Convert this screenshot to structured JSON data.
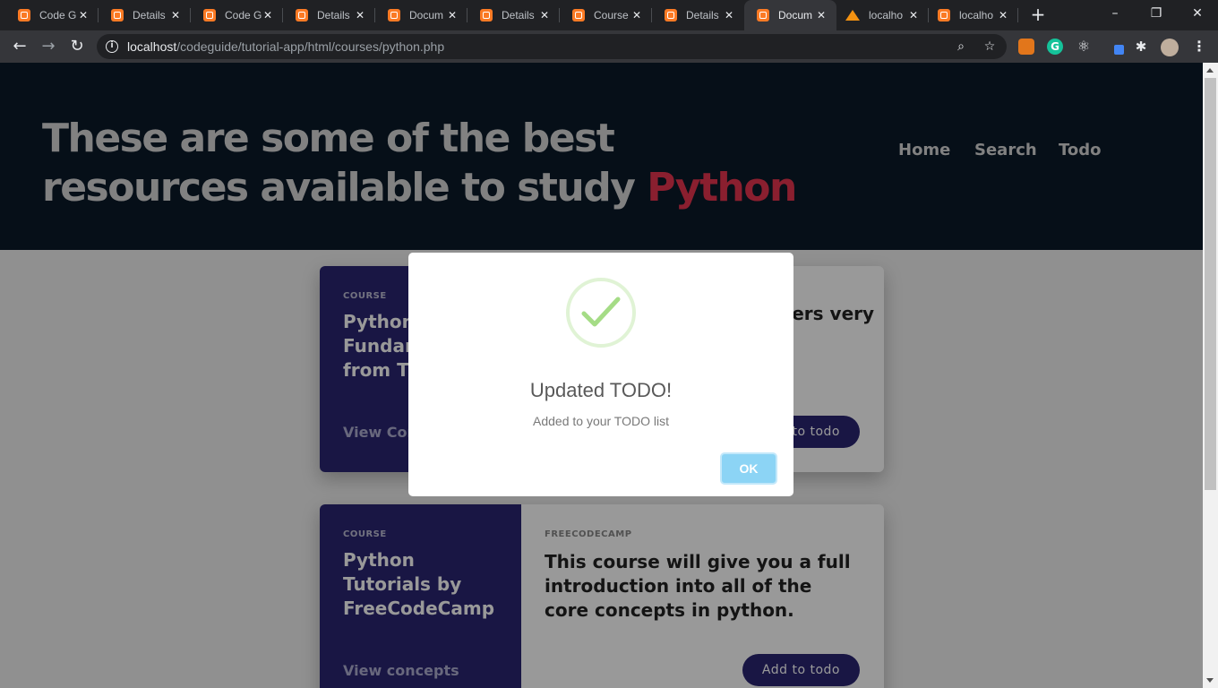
{
  "browser": {
    "tabs": [
      {
        "label": "Code G",
        "active": false
      },
      {
        "label": "Details",
        "active": false
      },
      {
        "label": "Code G",
        "active": false
      },
      {
        "label": "Details",
        "active": false
      },
      {
        "label": "Docum",
        "active": false
      },
      {
        "label": "Details",
        "active": false
      },
      {
        "label": "Course",
        "active": false
      },
      {
        "label": "Details",
        "active": false
      },
      {
        "label": "Docum",
        "active": true
      },
      {
        "label": "localho",
        "active": false
      },
      {
        "label": "localho",
        "active": false
      }
    ],
    "url_host": "localhost",
    "url_path": "/codeguide/tutorial-app/html/courses/python.php",
    "icons": {
      "back": "arrow-left-icon",
      "forward": "arrow-right-icon",
      "reload": "reload-icon",
      "zoom": "zoom-out-icon",
      "bookmark": "star-icon",
      "extensions": "puzzle-icon",
      "menu": "kebab-menu-icon"
    }
  },
  "hero": {
    "title_main": "These are some of the best resources available to study ",
    "title_accent": "Python",
    "nav": [
      "Home",
      "Search",
      "Todo"
    ]
  },
  "cards": [
    {
      "kicker": "COURSE",
      "title": "Python Fundamentals from T",
      "view_label": "View Cor",
      "source": "",
      "description": "ners very",
      "button_label": "to todo"
    },
    {
      "kicker": "COURSE",
      "title": "Python Tutorials by FreeCodeCamp",
      "view_label": "View concepts",
      "source": "FREECODECAMP",
      "description": "This course will give you a full introduction into all of the core concepts in python.",
      "button_label": "Add to todo"
    }
  ],
  "modal": {
    "title": "Updated TODO!",
    "text": "Added to your TODO list",
    "ok_label": "OK"
  },
  "colors": {
    "hero_bg": "#0a1929",
    "accent": "#e6354f",
    "card_side": "#2a2672",
    "success": "#a5dc86",
    "ok_button": "#8cd4f5"
  }
}
